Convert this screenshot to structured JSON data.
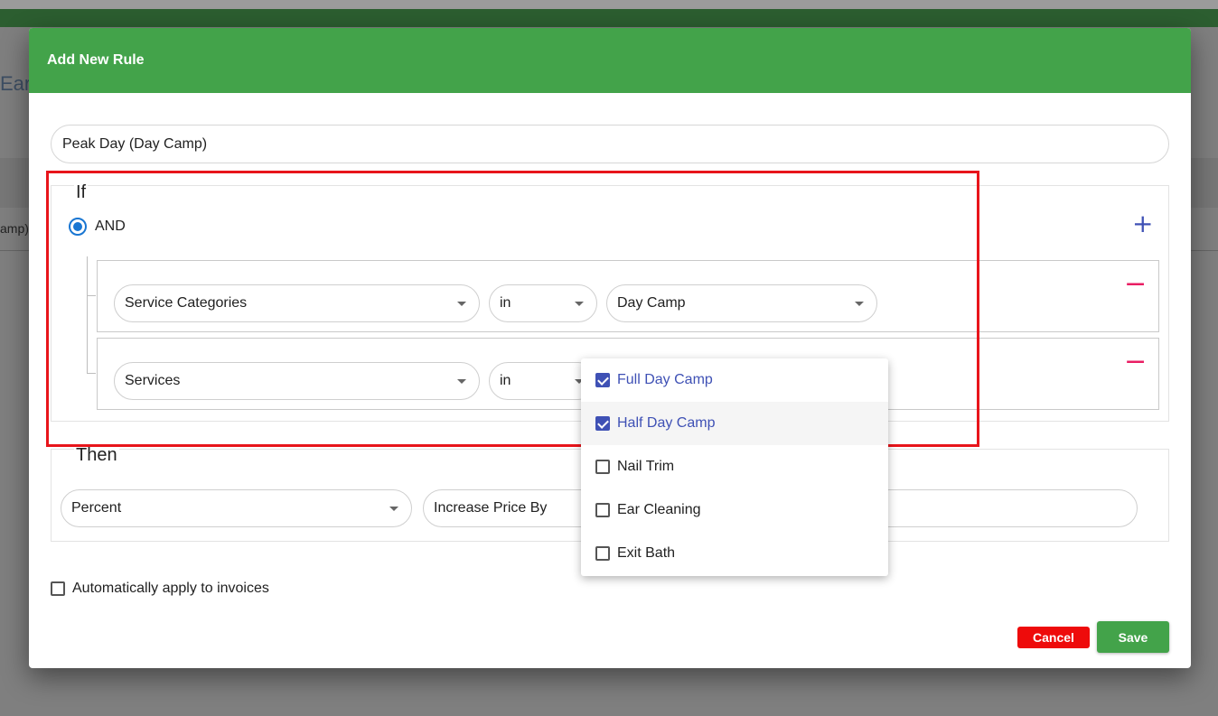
{
  "background": {
    "title_fragment": "Ear",
    "row_fragment": "amp)"
  },
  "dialog": {
    "title": "Add New Rule",
    "rule_name_value": "Peak Day (Day Camp)"
  },
  "if_section": {
    "legend": "If",
    "operator_label": "AND",
    "add_icon": "plus-icon",
    "conditions": [
      {
        "field": "Service Categories",
        "operator": "in",
        "value": "Day Camp",
        "remove_icon": "minus-icon"
      },
      {
        "field": "Services",
        "operator": "in",
        "remove_icon": "minus-icon"
      }
    ]
  },
  "then_section": {
    "legend": "Then",
    "type": "Percent",
    "action": "Increase Price By"
  },
  "services_menu": {
    "options": [
      {
        "label": "Full Day Camp",
        "checked": true
      },
      {
        "label": "Half Day Camp",
        "checked": true
      },
      {
        "label": "Nail Trim",
        "checked": false
      },
      {
        "label": "Ear Cleaning",
        "checked": false
      },
      {
        "label": "Exit Bath",
        "checked": false
      }
    ]
  },
  "auto_apply": {
    "label": "Automatically apply to invoices",
    "checked": false
  },
  "footer": {
    "cancel_label": "Cancel",
    "save_label": "Save"
  },
  "colors": {
    "header_green": "#43a34a",
    "accent_blue": "#3f51b5",
    "remove_pink": "#e91e63",
    "cancel_red": "#ee0b0b",
    "highlight_red": "#e8151b"
  }
}
